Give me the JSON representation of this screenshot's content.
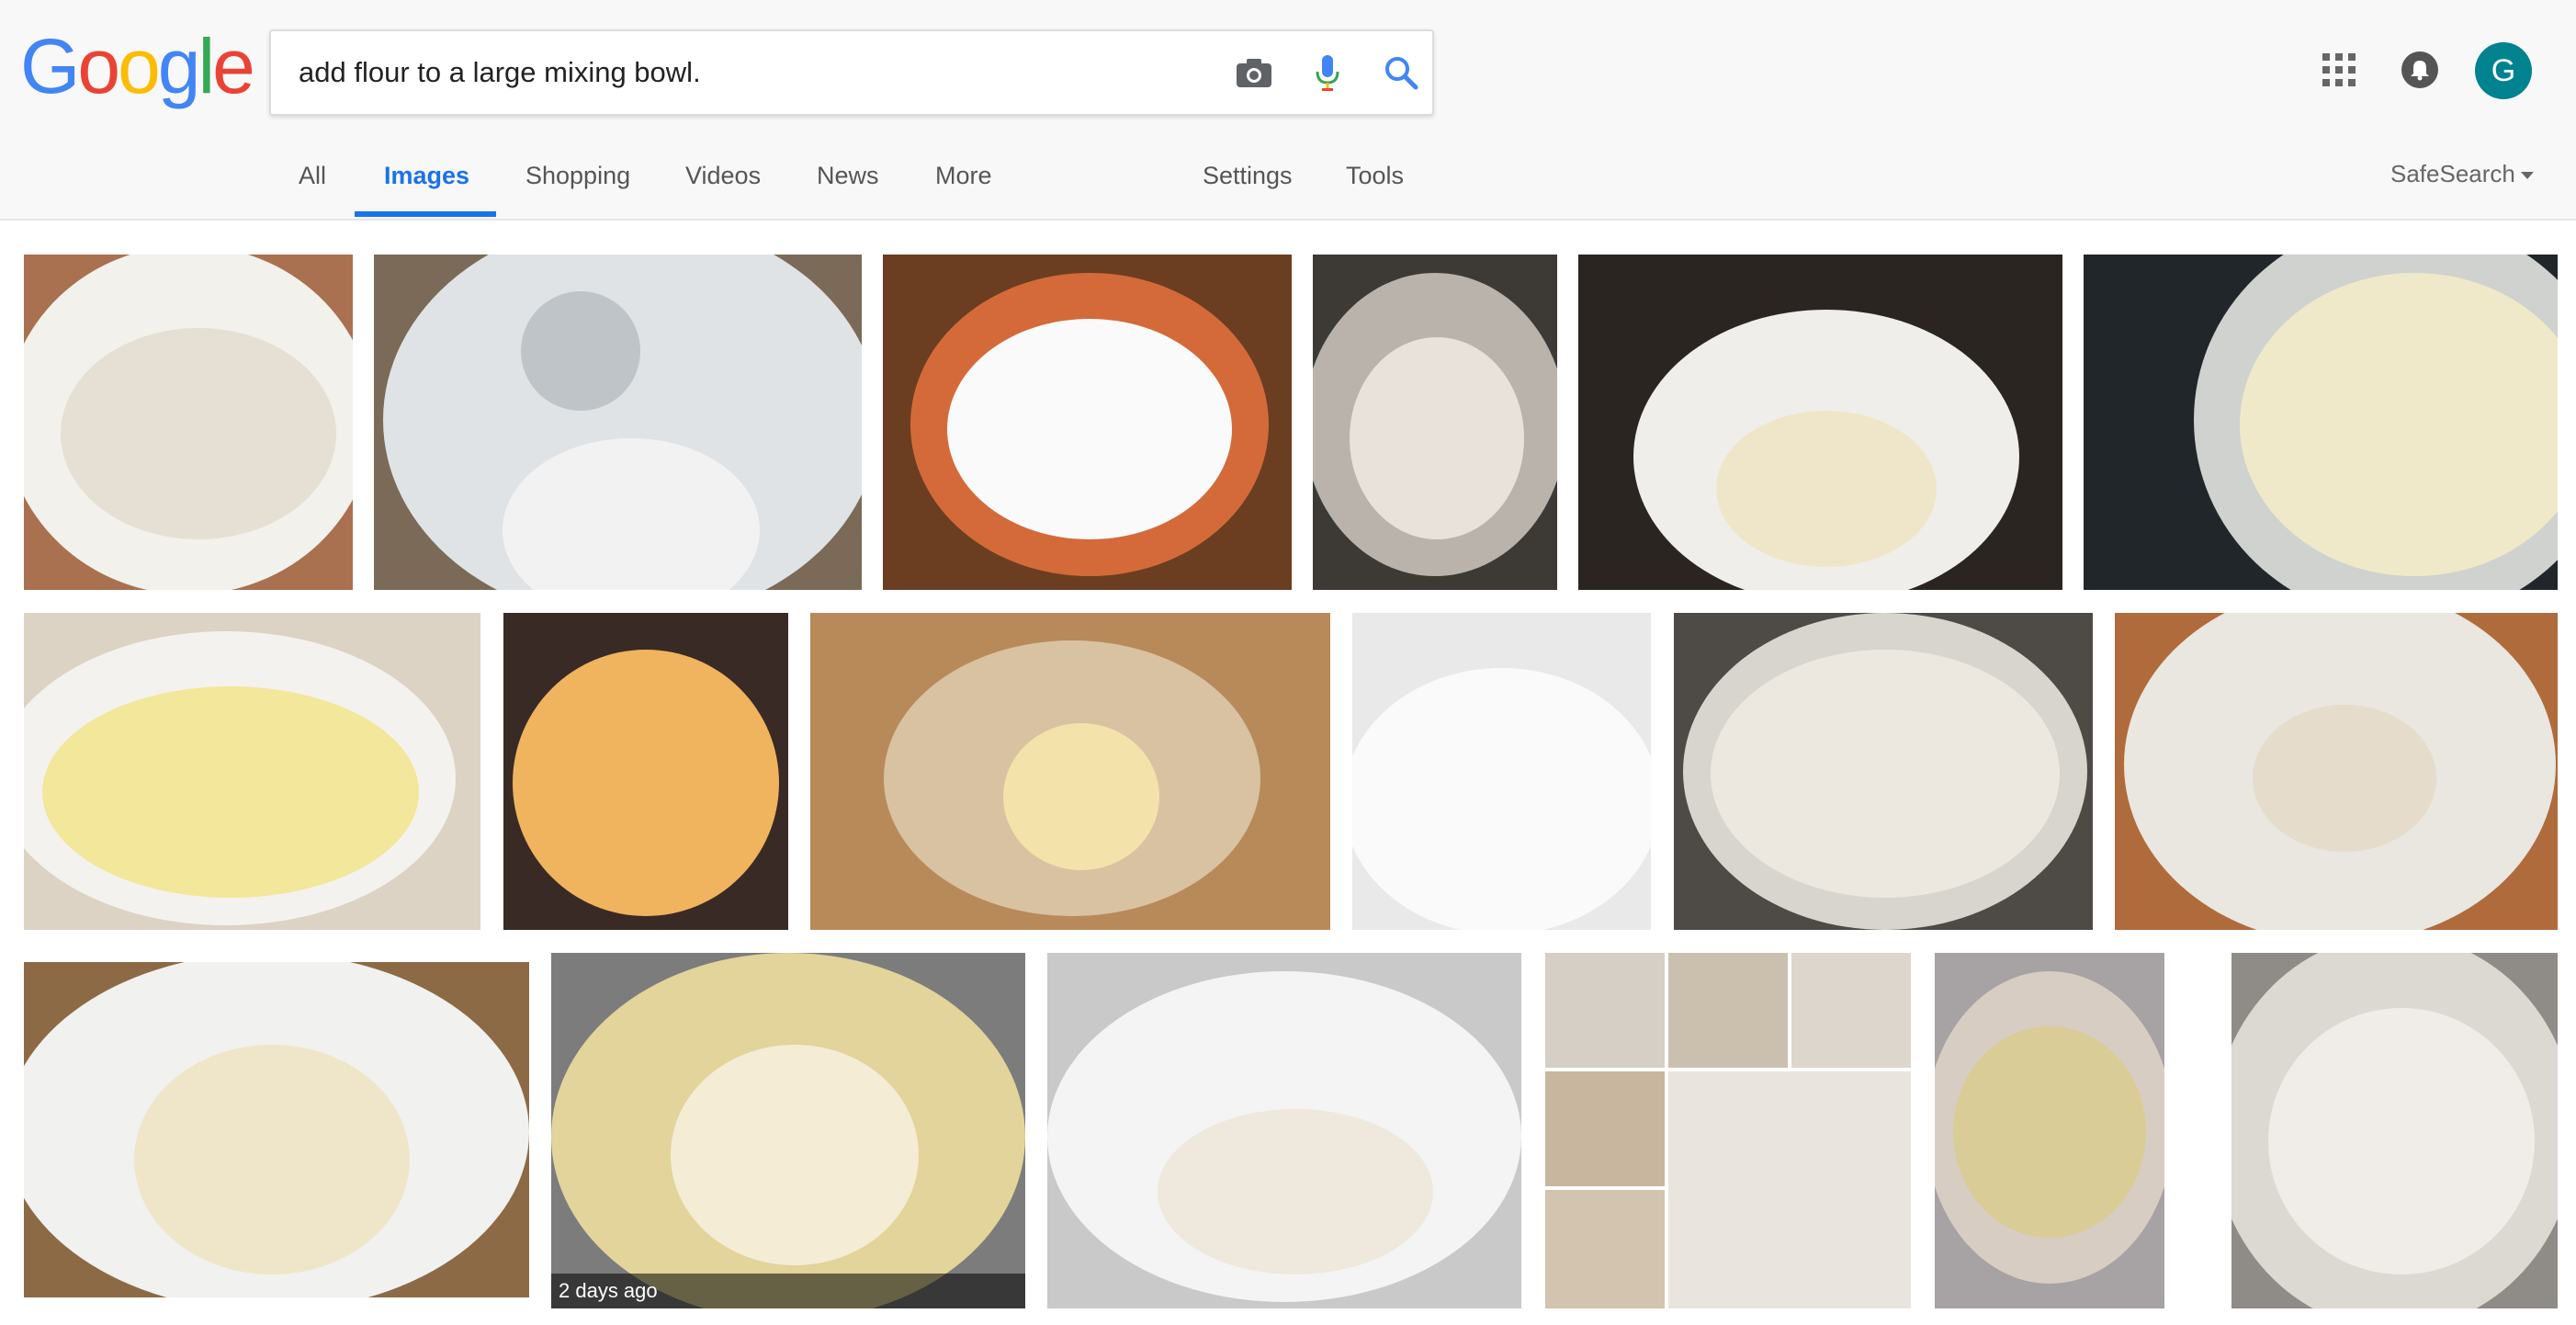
{
  "logo": {
    "letters": [
      "G",
      "o",
      "o",
      "g",
      "l",
      "e"
    ],
    "colors": [
      "#4285f4",
      "#ea4335",
      "#fbbc05",
      "#4285f4",
      "#34a853",
      "#ea4335"
    ]
  },
  "search": {
    "query": "add flour to a large mixing bowl.",
    "camera_icon": "camera-icon",
    "mic_icon": "microphone-icon",
    "search_icon": "search-icon"
  },
  "header": {
    "apps_icon": "apps-grid-icon",
    "notifications_icon": "bell-icon",
    "avatar_letter": "G",
    "avatar_color": "#00838f"
  },
  "tabs": [
    {
      "label": "All"
    },
    {
      "label": "Images",
      "active": true
    },
    {
      "label": "Shopping"
    },
    {
      "label": "Videos"
    },
    {
      "label": "News"
    },
    {
      "label": "More"
    },
    {
      "label": "Settings"
    },
    {
      "label": "Tools"
    }
  ],
  "safesearch": {
    "label": "SafeSearch"
  },
  "accent_color": "#1a73e8",
  "results": {
    "image_count": 18,
    "badges": {
      "row3_tile2": "2 days ago"
    }
  }
}
